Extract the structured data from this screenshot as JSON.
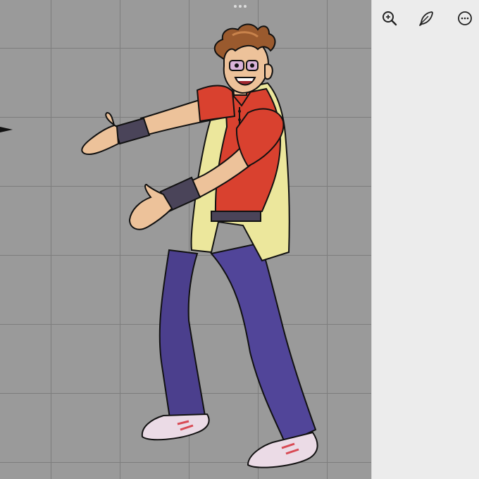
{
  "app": {
    "canvas": {
      "label": "",
      "grid": true
    },
    "toolbar": {
      "icons": [
        "zoom-in-icon",
        "feather-pen-icon",
        "more-options-icon"
      ]
    },
    "artwork": {
      "subject": "cartoon-character-drawing"
    },
    "colors": {
      "canvas_bg": "#9a9a9a",
      "grid_line": "#7d7d7d",
      "panel_bg": "#ececec",
      "shirt": "#d9412f",
      "vest": "#ece79c",
      "pants": "#4b3f8d",
      "hair": "#9a5a2e",
      "skin": "#edc29a",
      "shoes": "#ebdbe6"
    }
  }
}
